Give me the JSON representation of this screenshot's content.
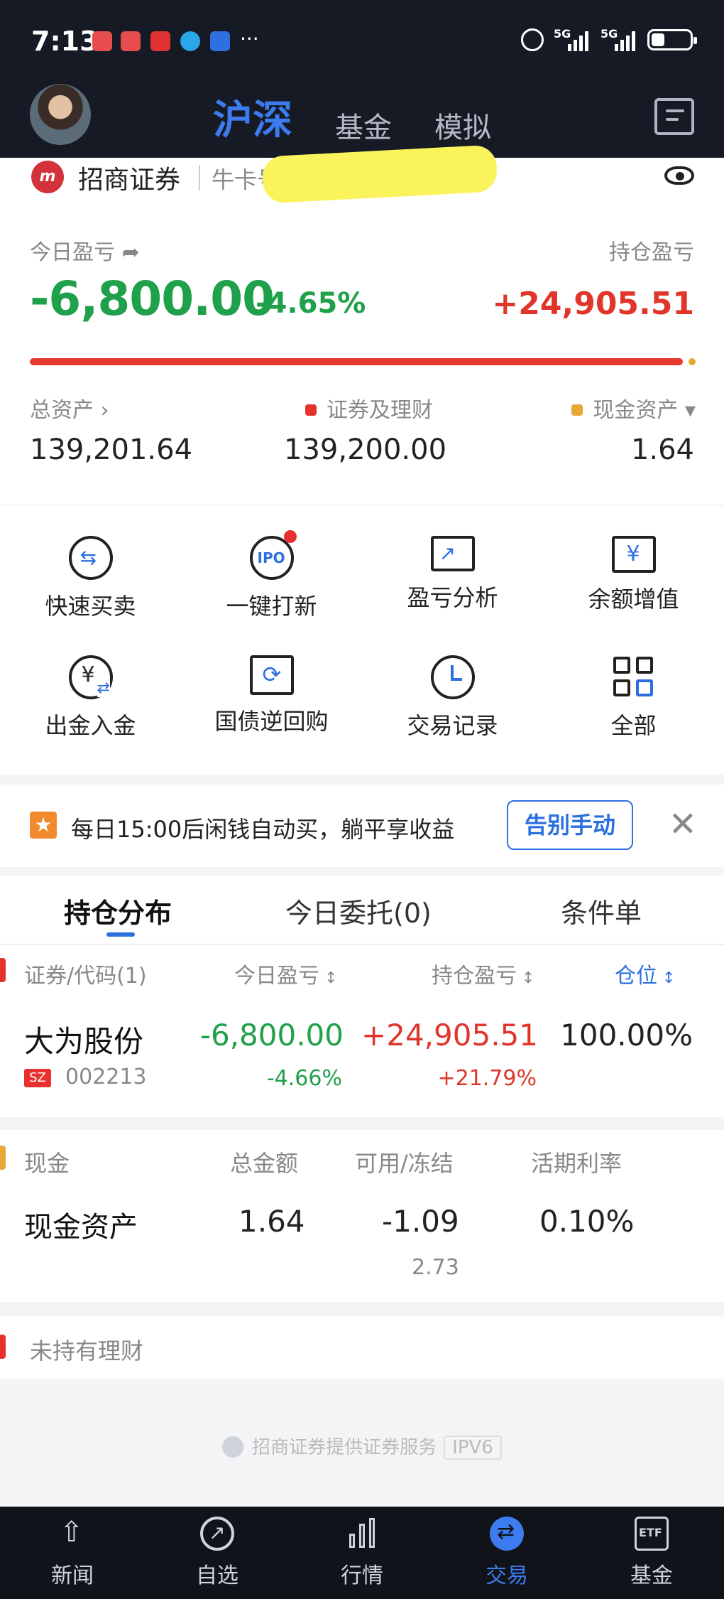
{
  "status_bar": {
    "time": "7:13",
    "dots": "···",
    "net1": "5G",
    "net2": "5G"
  },
  "top_nav": {
    "tabs": [
      "沪深",
      "基金",
      "模拟"
    ],
    "active_tab": "沪深"
  },
  "account": {
    "broker": "招商证券",
    "niu_label": "牛卡号:",
    "today_pnl_label": "今日盈亏",
    "hold_pnl_label": "持仓盈亏",
    "today_pnl": "-6,800.00",
    "today_pnl_pct": "-4.65%",
    "hold_pnl": "+24,905.51",
    "total_assets_label": "总资产",
    "securities_label": "证券及理财",
    "cash_label": "现金资产",
    "total_assets": "139,201.64",
    "securities": "139,200.00",
    "cash": "1.64"
  },
  "quick_actions": [
    {
      "label": "快速买卖",
      "icon": "swap-icon"
    },
    {
      "label": "一键打新",
      "icon": "ipo-icon",
      "ic_text": "IPO"
    },
    {
      "label": "盈亏分析",
      "icon": "chart-monitor-icon"
    },
    {
      "label": "余额增值",
      "icon": "yen-ticket-icon",
      "ic_text": "¥"
    },
    {
      "label": "出金入金",
      "icon": "yen-transfer-icon",
      "ic_text": "¥"
    },
    {
      "label": "国债逆回购",
      "icon": "refresh-ticket-icon"
    },
    {
      "label": "交易记录",
      "icon": "clock-icon"
    },
    {
      "label": "全部",
      "icon": "grid-icon"
    }
  ],
  "promo": {
    "text": "每日15:00后闲钱自动买，躺平享收益",
    "button": "告别手动"
  },
  "holdings": {
    "tabs": [
      "持仓分布",
      "今日委托(0)",
      "条件单"
    ],
    "columns": [
      "证券/代码(1)",
      "今日盈亏",
      "持仓盈亏",
      "仓位"
    ],
    "rows": [
      {
        "name": "大为股份",
        "market": "SZ",
        "code": "002213",
        "today_pnl": "-6,800.00",
        "today_pct": "-4.66%",
        "hold_pnl": "+24,905.51",
        "hold_pct": "+21.79%",
        "position": "100.00%"
      }
    ]
  },
  "cash_section": {
    "columns": [
      "现金",
      "总金额",
      "可用/冻结",
      "活期利率"
    ],
    "name": "现金资产",
    "total": "1.64",
    "available": "-1.09",
    "frozen": "2.73",
    "rate": "0.10%"
  },
  "no_wealth": "未持有理财",
  "footer": {
    "text": "招商证券提供证券服务",
    "badge": "IPV6"
  },
  "bottom_nav": [
    {
      "label": "新闻",
      "icon": "news-icon"
    },
    {
      "label": "自选",
      "icon": "trend-icon"
    },
    {
      "label": "行情",
      "icon": "bar-chart-icon"
    },
    {
      "label": "交易",
      "icon": "trade-icon"
    },
    {
      "label": "基金",
      "icon": "etf-icon",
      "ic_text": "ETF"
    }
  ],
  "colors": {
    "accent": "#3c7bf0",
    "up": "#e0352b",
    "down": "#1fa04a",
    "dark": "#161a24"
  }
}
